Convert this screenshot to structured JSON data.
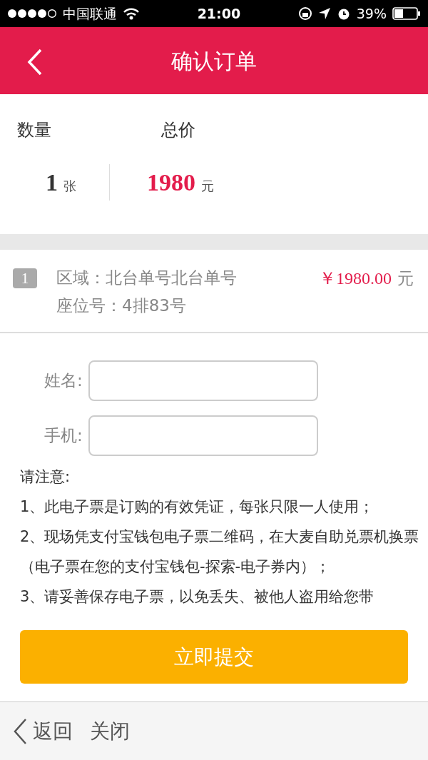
{
  "status_bar": {
    "carrier": "中国联通",
    "time": "21:00",
    "battery": "39%"
  },
  "header": {
    "title": "确认订单"
  },
  "summary": {
    "quantity_label": "数量",
    "total_label": "总价",
    "quantity": "1",
    "quantity_unit": "张",
    "total": "1980",
    "total_unit": "元"
  },
  "tickets": [
    {
      "index": "1",
      "area": "区域：北台单号北台单号",
      "seat": "座位号：4排83号",
      "price": "￥1980.00",
      "price_unit": "元"
    }
  ],
  "form": [
    {
      "label": "姓名:"
    },
    {
      "label": "手机:"
    }
  ],
  "notes": {
    "title": "请注意:",
    "items": [
      "1、此电子票是订购的有效凭证，每张只限一人使用；",
      "2、现场凭支付宝钱包电子票二维码，在大麦自助兑票机换票（电子票在您的支付宝钱包-探索-电子券内）；",
      "3、请妥善保存电子票，以免丢失、被他人盗用给您带"
    ]
  },
  "submit": "立即提交",
  "toolbar": {
    "back": "返回",
    "close": "关闭"
  }
}
